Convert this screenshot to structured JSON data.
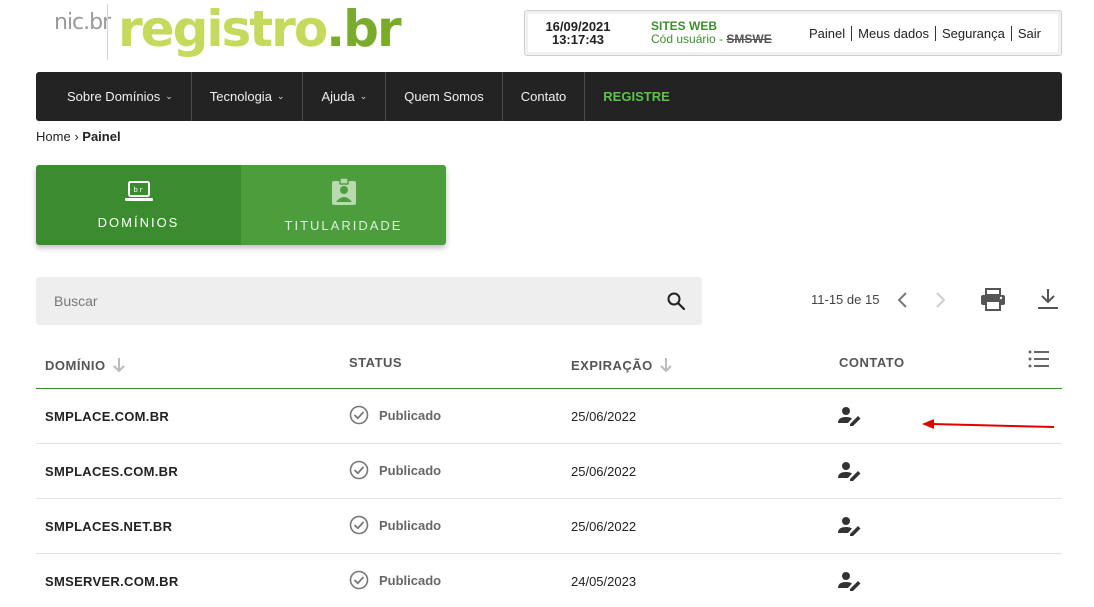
{
  "logo": {
    "nic": "nic",
    "nic_br": ".br",
    "registro": "registro",
    "registro_br": ".br"
  },
  "userbox": {
    "date": "16/09/2021",
    "time": "13:17:43",
    "site_label": "SITES WEB",
    "user_code_label": "Cód usuário -",
    "user_code": "SMSWE",
    "links": [
      "Painel",
      "Meus dados",
      "Segurança",
      "Sair"
    ]
  },
  "nav": {
    "items": [
      {
        "label": "Sobre Domínios",
        "dropdown": true
      },
      {
        "label": "Tecnologia",
        "dropdown": true
      },
      {
        "label": "Ajuda",
        "dropdown": true
      },
      {
        "label": "Quem Somos",
        "dropdown": false
      },
      {
        "label": "Contato",
        "dropdown": false
      },
      {
        "label": "REGISTRE",
        "dropdown": false
      }
    ]
  },
  "breadcrumb": {
    "home": "Home",
    "sep": "›",
    "current": "Painel"
  },
  "tabs": [
    {
      "label": "DOMÍNIOS",
      "active": true,
      "icon": "laptop-br-icon"
    },
    {
      "label": "TITULARIDADE",
      "active": false,
      "icon": "badge-icon"
    }
  ],
  "search": {
    "placeholder": "Buscar",
    "value": ""
  },
  "pager": {
    "text": "11-15 de 15"
  },
  "table": {
    "headers": {
      "domain": "DOMÍNIO",
      "status": "STATUS",
      "expiration": "EXPIRAÇÃO",
      "contact": "CONTATO"
    },
    "rows": [
      {
        "domain": "SMPLACE.COM.BR",
        "status": "Publicado",
        "expiration": "25/06/2022"
      },
      {
        "domain": "SMPLACES.COM.BR",
        "status": "Publicado",
        "expiration": "25/06/2022"
      },
      {
        "domain": "SMPLACES.NET.BR",
        "status": "Publicado",
        "expiration": "25/06/2022"
      },
      {
        "domain": "SMSERVER.COM.BR",
        "status": "Publicado",
        "expiration": "24/05/2023"
      }
    ]
  },
  "colors": {
    "brand_green": "#3b8c2f",
    "nav_bg": "#232323",
    "registre": "#5ec24a",
    "annotation_arrow": "#e00000"
  }
}
